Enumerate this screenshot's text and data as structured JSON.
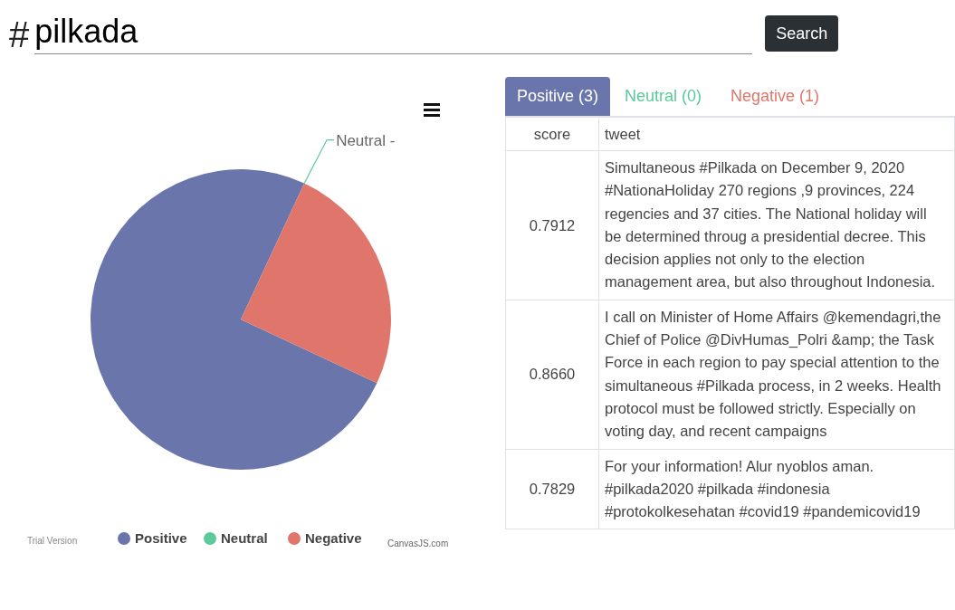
{
  "search": {
    "prefix": "#",
    "value": "pilkada",
    "button": "Search"
  },
  "chart": {
    "trial_text": "Trial Version",
    "credit": "CanvasJS.com",
    "chart_data": {
      "type": "pie",
      "categories": [
        "Positive",
        "Neutral",
        "Negative"
      ],
      "values": [
        75,
        0,
        25
      ],
      "colors": [
        "#6a76ab",
        "#5cc99a",
        "#e0756b"
      ],
      "legend": "bottom",
      "annotations": [
        {
          "x": "Neutral",
          "text": "Neutral -"
        }
      ]
    }
  },
  "tabs": [
    {
      "label": "Positive (3)",
      "selected": true,
      "color": "#6a76ab"
    },
    {
      "label": "Neutral (0)",
      "selected": false,
      "color": "#5cc99a"
    },
    {
      "label": "Negative (1)",
      "selected": false,
      "color": "#e0756b"
    }
  ],
  "table": {
    "columns": [
      "score",
      "tweet"
    ],
    "rows": [
      {
        "score": "0.7912",
        "tweet": "Simultaneous #Pilkada on December 9, 2020 #NationaHoliday 270 regions ,9 provinces, 224 regencies and 37 cities. The National holiday will be determined throug a presidential decree. This decision applies not only to the election management area, but also throughout Indonesia."
      },
      {
        "score": "0.8660",
        "tweet": "I call on Minister of Home Affairs @kemendagri,the Chief of Police @DivHumas_Polri &amp; the Task Force in each region to pay special attention to the simultaneous #Pilkada process, in 2 weeks. Health protocol must be followed strictly. Especially on voting day, and recent campaigns"
      },
      {
        "score": "0.7829",
        "tweet": "For your information! Alur nyoblos aman. #pilkada2020 #pilkada #indonesia #protokolkesehatan #covid19 #pandemicovid19"
      }
    ]
  }
}
